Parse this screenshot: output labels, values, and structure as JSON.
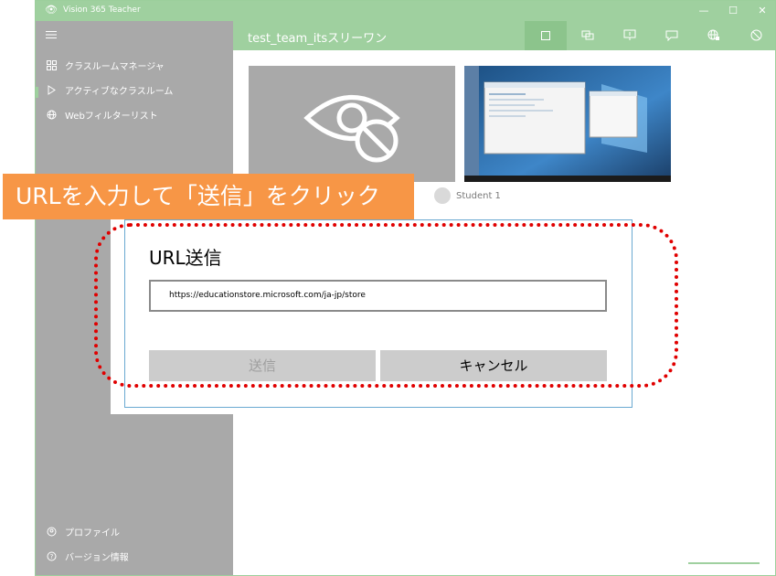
{
  "window": {
    "title": "Vision 365 Teacher",
    "controls": {
      "minimize": "—",
      "maximize": "☐",
      "close": "✕"
    }
  },
  "sidebar": {
    "menu_icon": "hamburger-icon",
    "items": [
      {
        "label": "クラスルームマネージャ",
        "icon": "grid-icon"
      },
      {
        "label": "アクティブなクラスルーム",
        "icon": "play-icon"
      },
      {
        "label": "Webフィルターリスト",
        "icon": "globe-icon"
      }
    ],
    "footer": [
      {
        "label": "プロファイル",
        "icon": "profile-icon"
      },
      {
        "label": "バージョン情報",
        "icon": "help-icon"
      }
    ]
  },
  "header": {
    "title": "test_team_itsスリーワン",
    "tools": [
      "square-icon",
      "screens-icon",
      "presentation-icon",
      "message-icon",
      "web-icon",
      "block-icon"
    ]
  },
  "students": [
    {
      "name": "Student 1"
    }
  ],
  "callout": {
    "text": "URLを入力して「送信」をクリック"
  },
  "dialog": {
    "title": "URL送信",
    "url_value": "https://educationstore.microsoft.com/ja-jp/store",
    "send_label": "送信",
    "cancel_label": "キャンセル"
  },
  "colors": {
    "accent": "#9fd09f",
    "sidebar": "#a9a9a9",
    "callout": "#f79646",
    "highlight": "#e00000"
  }
}
